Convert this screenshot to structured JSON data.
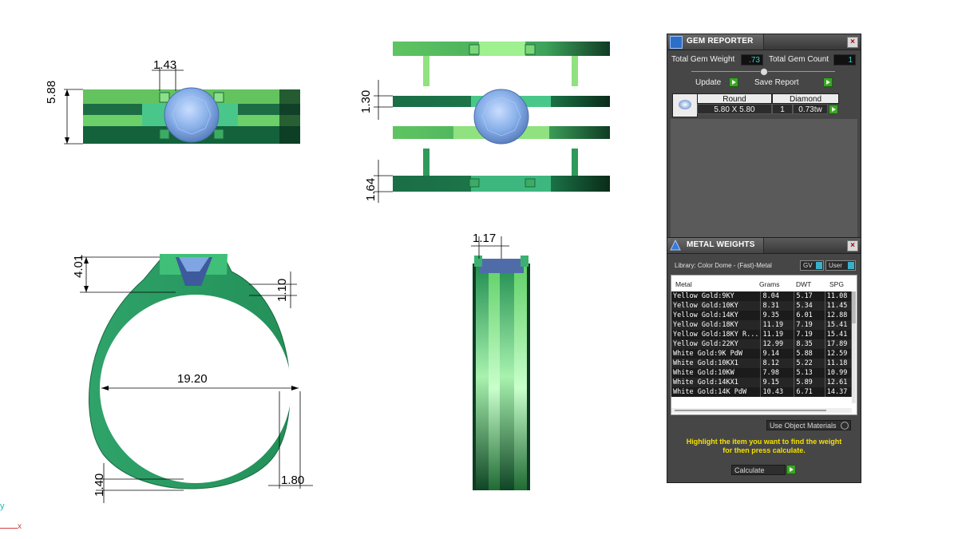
{
  "dimensions": {
    "top_width": "1.43",
    "top_height": "5.88",
    "side_gap_top": "1.30",
    "side_gap_bottom": "1.64",
    "front_stone_height": "4.01",
    "front_shoulder": "1.10",
    "front_diameter": "19.20",
    "front_bottom_thickness": "1.40",
    "front_side_width": "1.80",
    "profile_top_width": "1.17"
  },
  "gem_reporter": {
    "title": "GEM REPORTER",
    "total_weight_label": "Total Gem Weight",
    "total_weight_value": ".73",
    "total_count_label": "Total Gem Count",
    "total_count_value": "1",
    "update_label": "Update",
    "save_report_label": "Save Report",
    "gem_table": {
      "shape_header": "Round",
      "type_header": "Diamond",
      "size": "5.80 X 5.80",
      "count": "1",
      "weight": "0.73tw"
    }
  },
  "metal_weights": {
    "title": "METAL WEIGHTS",
    "library_label": "Library: Color Dome - (Fast)-Metal",
    "gv_label": "GV",
    "user_label": "User",
    "columns": [
      "Metal",
      "Grams",
      "DWT",
      "SPG"
    ],
    "rows": [
      [
        "Yellow Gold:9KY",
        "8.04",
        "5.17",
        "11.08"
      ],
      [
        "Yellow Gold:10KY",
        "8.31",
        "5.34",
        "11.45"
      ],
      [
        "Yellow Gold:14KY",
        "9.35",
        "6.01",
        "12.88"
      ],
      [
        "Yellow Gold:18KY",
        "11.19",
        "7.19",
        "15.41"
      ],
      [
        "Yellow Gold:18KY R...",
        "11.19",
        "7.19",
        "15.41"
      ],
      [
        "Yellow Gold:22KY",
        "12.99",
        "8.35",
        "17.89"
      ],
      [
        "White Gold:9K PdW",
        "9.14",
        "5.88",
        "12.59"
      ],
      [
        "White Gold:10KX1",
        "8.12",
        "5.22",
        "11.18"
      ],
      [
        "White Gold:10KW",
        "7.98",
        "5.13",
        "10.99"
      ],
      [
        "White Gold:14KX1",
        "9.15",
        "5.89",
        "12.61"
      ],
      [
        "White Gold:14K PdW",
        "10.43",
        "6.71",
        "14.37"
      ]
    ],
    "use_object_materials_label": "Use Object Materials",
    "hint_line1": "Highlight the item you want to find the weight",
    "hint_line2": "for then press calculate.",
    "calculate_label": "Calculate"
  },
  "axis": {
    "y_label": "y",
    "x_label": "x"
  },
  "colors": {
    "metal_dark": "#1f7a4a",
    "metal_light": "#7fdc7a",
    "stone": "#86aee8",
    "hint_text": "#f5e000",
    "panel_bg": "#464646"
  }
}
